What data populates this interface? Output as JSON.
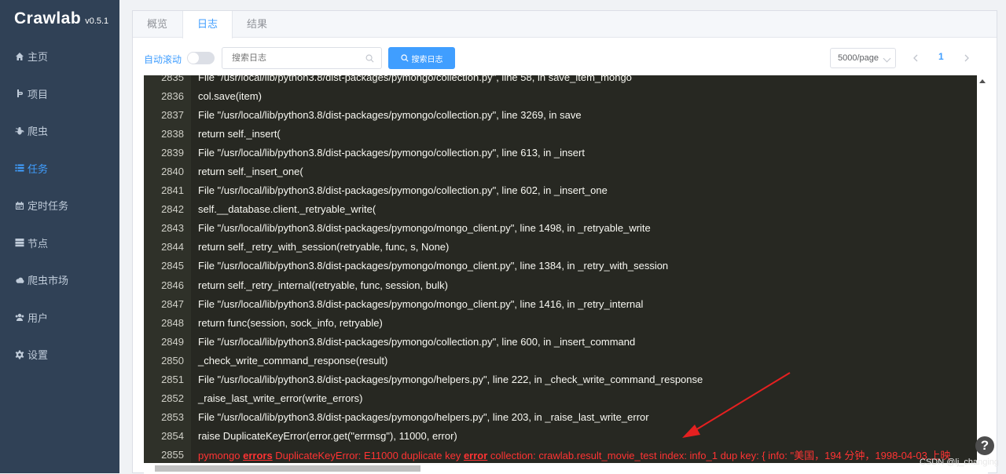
{
  "app": {
    "name": "Crawlab",
    "version": "v0.5.1"
  },
  "menu": [
    {
      "label": "主页",
      "icon": "home-icon"
    },
    {
      "label": "项目",
      "icon": "project-icon"
    },
    {
      "label": "爬虫",
      "icon": "bug-icon"
    },
    {
      "label": "任务",
      "icon": "list-icon",
      "active": true
    },
    {
      "label": "定时任务",
      "icon": "calendar-icon"
    },
    {
      "label": "节点",
      "icon": "server-icon"
    },
    {
      "label": "爬虫市场",
      "icon": "cloud-icon"
    },
    {
      "label": "用户",
      "icon": "users-icon"
    },
    {
      "label": "设置",
      "icon": "gear-icon"
    }
  ],
  "tabs": [
    {
      "label": "概览"
    },
    {
      "label": "日志",
      "active": true
    },
    {
      "label": "结果"
    }
  ],
  "toolbar": {
    "auto_scroll_label": "自动滚动",
    "search_placeholder": "搜索日志",
    "search_button": "搜索日志",
    "page_size": "5000/page",
    "current_page": "1"
  },
  "log": {
    "lines": [
      {
        "num": "2835",
        "text": "File \"/usr/local/lib/python3.8/dist-packages/pymongo/collection.py\", line 58, in save_item_mongo"
      },
      {
        "num": "2836",
        "text": "col.save(item)"
      },
      {
        "num": "2837",
        "text": "File \"/usr/local/lib/python3.8/dist-packages/pymongo/collection.py\", line 3269, in save"
      },
      {
        "num": "2838",
        "text": "return self._insert("
      },
      {
        "num": "2839",
        "text": "File \"/usr/local/lib/python3.8/dist-packages/pymongo/collection.py\", line 613, in _insert"
      },
      {
        "num": "2840",
        "text": "return self._insert_one("
      },
      {
        "num": "2841",
        "text": "File \"/usr/local/lib/python3.8/dist-packages/pymongo/collection.py\", line 602, in _insert_one"
      },
      {
        "num": "2842",
        "text": "self.__database.client._retryable_write("
      },
      {
        "num": "2843",
        "text": "File \"/usr/local/lib/python3.8/dist-packages/pymongo/mongo_client.py\", line 1498, in _retryable_write"
      },
      {
        "num": "2844",
        "text": "return self._retry_with_session(retryable, func, s, None)"
      },
      {
        "num": "2845",
        "text": "File \"/usr/local/lib/python3.8/dist-packages/pymongo/mongo_client.py\", line 1384, in _retry_with_session"
      },
      {
        "num": "2846",
        "text": "return self._retry_internal(retryable, func, session, bulk)"
      },
      {
        "num": "2847",
        "text": "File \"/usr/local/lib/python3.8/dist-packages/pymongo/mongo_client.py\", line 1416, in _retry_internal"
      },
      {
        "num": "2848",
        "text": "return func(session, sock_info, retryable)"
      },
      {
        "num": "2849",
        "text": "File \"/usr/local/lib/python3.8/dist-packages/pymongo/collection.py\", line 600, in _insert_command"
      },
      {
        "num": "2850",
        "text": "_check_write_command_response(result)"
      },
      {
        "num": "2851",
        "text": "File \"/usr/local/lib/python3.8/dist-packages/pymongo/helpers.py\", line 222, in _check_write_command_response"
      },
      {
        "num": "2852",
        "text": "_raise_last_write_error(write_errors)"
      },
      {
        "num": "2853",
        "text": "File \"/usr/local/lib/python3.8/dist-packages/pymongo/helpers.py\", line 203, in _raise_last_write_error"
      },
      {
        "num": "2854",
        "text": "raise DuplicateKeyError(error.get(\"errmsg\"), 11000, error)"
      }
    ],
    "error_line": {
      "num": "2855",
      "part1": "pymongo ",
      "kw1": "errors",
      "part2": " DuplicateKeyError: E11000 duplicate key ",
      "kw2": "error",
      "part3": " collection: crawlab.result_movie_test index: info_1 dup key: { info: \"美国，194 分钟，1998-04-03 上映"
    }
  },
  "help_label": "?",
  "watermark": "CSDN @lj_changing",
  "colors": {
    "accent": "#409eff",
    "sidebar": "#304156",
    "log_bg": "#272822",
    "error": "#ff3333"
  }
}
